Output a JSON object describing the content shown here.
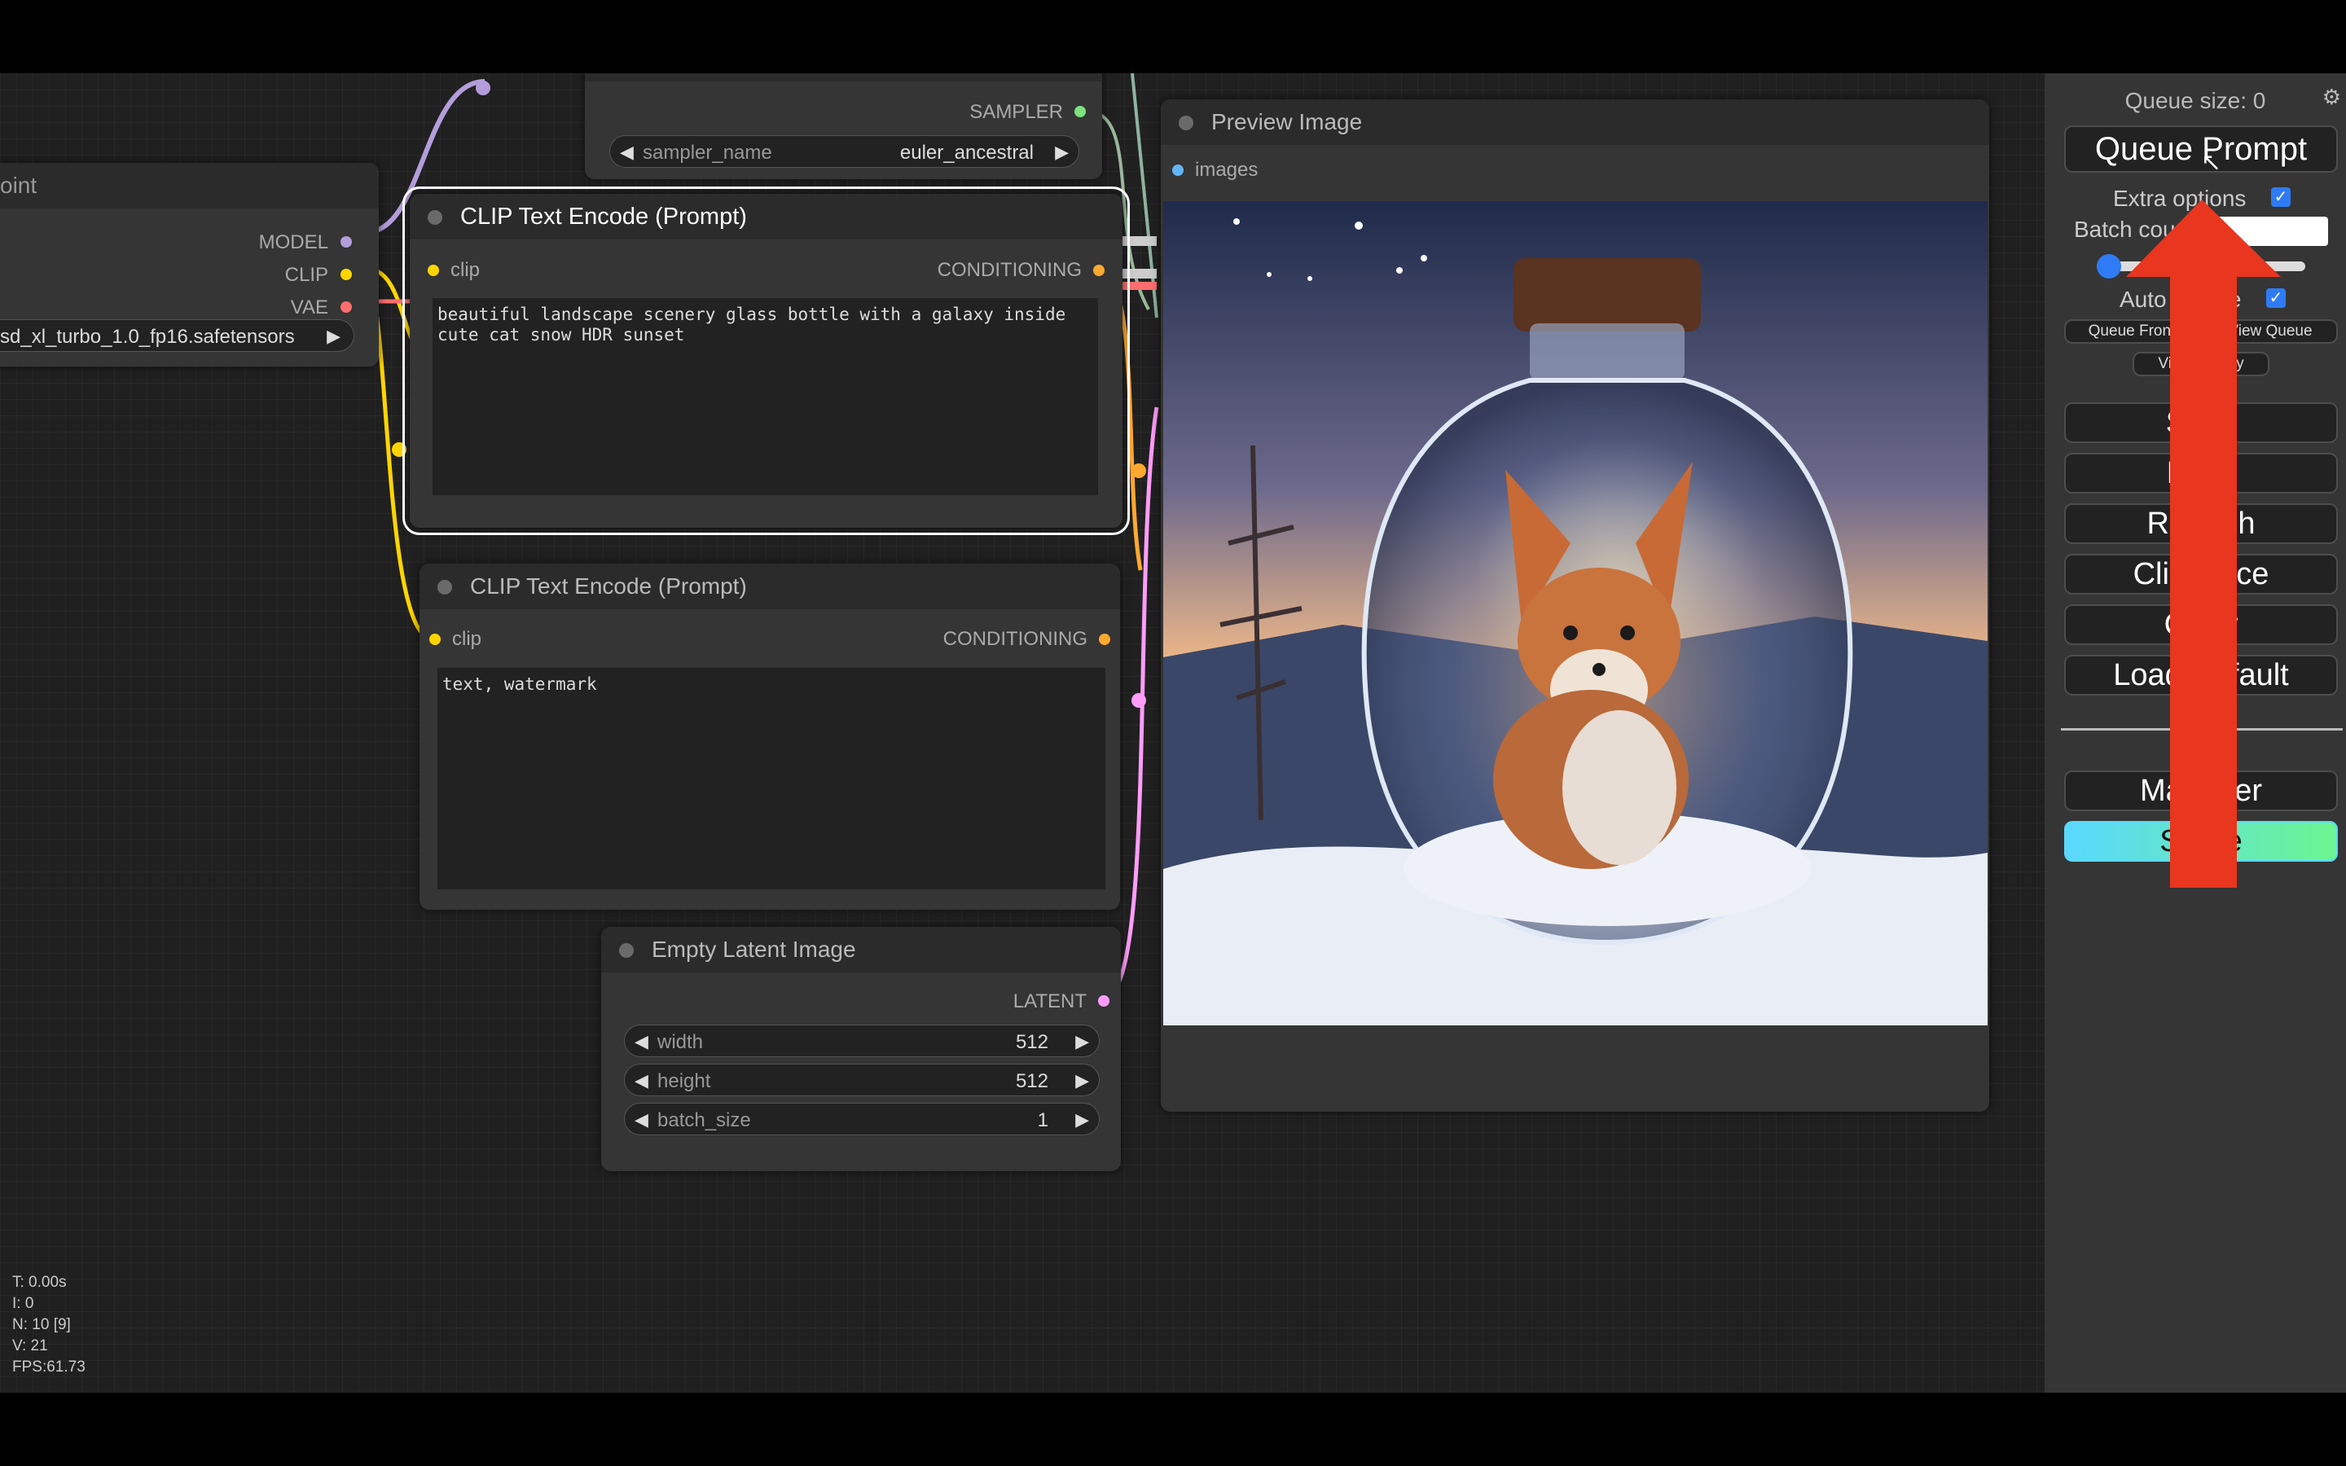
{
  "checkpoint_node": {
    "title": "oint",
    "outputs": [
      "MODEL",
      "CLIP",
      "VAE"
    ],
    "ckpt_value": "sd_xl_turbo_1.0_fp16.safetensors"
  },
  "sampler_node": {
    "output": "SAMPLER",
    "widget_label": "sampler_name",
    "widget_value": "euler_ancestral"
  },
  "clip_pos": {
    "title": "CLIP Text Encode (Prompt)",
    "input": "clip",
    "output": "CONDITIONING",
    "text": "beautiful landscape scenery glass bottle with a galaxy inside cute cat snow HDR sunset"
  },
  "clip_neg": {
    "title": "CLIP Text Encode (Prompt)",
    "input": "clip",
    "output": "CONDITIONING",
    "text": "text, watermark"
  },
  "latent_node": {
    "title": "Empty Latent Image",
    "output": "LATENT",
    "widgets": [
      {
        "label": "width",
        "value": "512"
      },
      {
        "label": "height",
        "value": "512"
      },
      {
        "label": "batch_size",
        "value": "1"
      }
    ]
  },
  "preview_node": {
    "title": "Preview Image",
    "input": "images"
  },
  "stats": [
    "T: 0.00s",
    "I: 0",
    "N: 10 [9]",
    "V: 21",
    "FPS:61.73"
  ],
  "panel": {
    "queue_size": "Queue size: 0",
    "queue_prompt": "Queue Prompt",
    "extra_options": "Extra options",
    "batch_count": "Batch count",
    "auto_queue": "Auto Queue",
    "queue_front": "Queue Front",
    "view_queue": "View Queue",
    "view_history": "View History",
    "buttons": [
      "Save",
      "Load",
      "Refresh",
      "Clipspace",
      "Clear",
      "Load Default"
    ],
    "manager": "Manager",
    "share": "Share",
    "gear_icon": "gear-icon"
  },
  "colors": {
    "canvas": "#202020",
    "node": "#353535",
    "model_link": "#b39ddb",
    "clip_link": "#ffd500",
    "vae_link": "#ff6e6e",
    "latent_link": "#ff9cf9",
    "conditioning_link": "#ffa931",
    "sampler_link": "#ecb4b4",
    "annotation_arrow": "#e8361f",
    "checkbox": "#2f7bf5",
    "share_gradient": [
      "#5ad8ff",
      "#6cf58f"
    ]
  }
}
